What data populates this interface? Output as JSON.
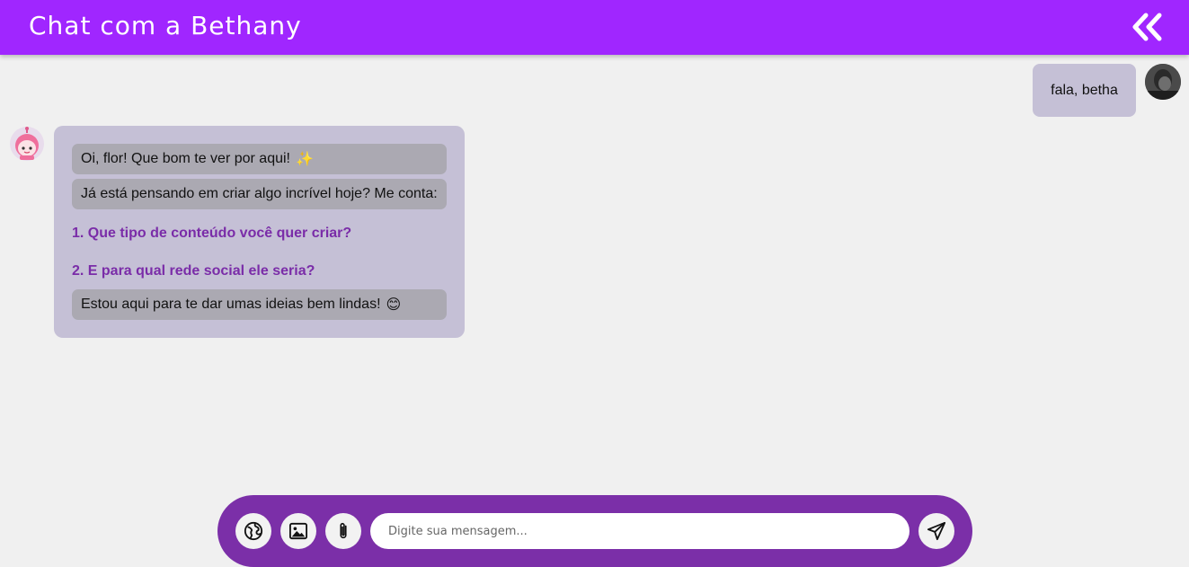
{
  "header": {
    "title": "Chat com a Bethany",
    "background": "#a026ff",
    "collapse_icon": "double-chevron-left-icon"
  },
  "conversation": {
    "user_message": {
      "text": "fala, betha",
      "avatar": "user-avatar-photo"
    },
    "bot_message": {
      "avatar": "bethany-avatar",
      "greeting": "Oi, flor! Que bom te ver por aqui!",
      "greeting_emoji": "✨",
      "prompt": "Já está pensando em criar algo incrível hoje? Me conta:",
      "questions": [
        "1. Que tipo de conteúdo você quer criar?",
        "2. E para qual rede social ele seria?"
      ],
      "closing": "Estou aqui para te dar umas ideias bem lindas!",
      "closing_emoji": "😊",
      "heading_color": "#7a2ca8"
    }
  },
  "composer": {
    "placeholder": "Digite sua mensagem...",
    "value": "",
    "buttons": [
      "globe-icon",
      "image-icon",
      "paperclip-icon",
      "send-icon"
    ],
    "background": "#7b2fa8"
  }
}
